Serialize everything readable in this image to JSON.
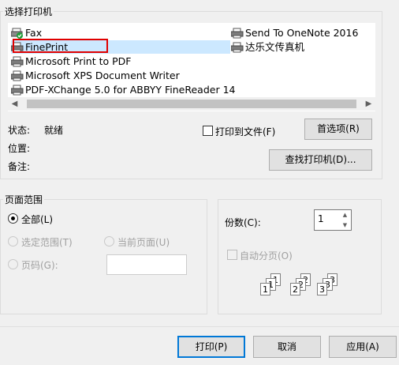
{
  "printer_group": {
    "title": "选择打印机"
  },
  "printers": {
    "col1": [
      "Fax",
      "FinePrint",
      "Microsoft Print to PDF",
      "Microsoft XPS Document Writer",
      "PDF-XChange 5.0 for ABBYY FineReader 14"
    ],
    "col2": [
      "Send To OneNote 2016",
      "达乐文传真机"
    ],
    "selected": "FinePrint",
    "highlight_color": "#e00000"
  },
  "info": {
    "status_label": "状态:",
    "status_value": "就绪",
    "location_label": "位置:",
    "comment_label": "备注:"
  },
  "print_to_file": {
    "label": "打印到文件(F)",
    "checked": false
  },
  "buttons": {
    "preferences": "首选项(R)",
    "find_printer": "查找打印机(D)...",
    "print": "打印(P)",
    "cancel": "取消",
    "apply": "应用(A)"
  },
  "page_range": {
    "title": "页面范围",
    "all": "全部(L)",
    "selection": "选定范围(T)",
    "current_page": "当前页面(U)",
    "pages": "页码(G):",
    "pages_value": ""
  },
  "copies": {
    "label": "份数(C):",
    "value": "1",
    "collate_label": "自动分页(O)",
    "collate_checked": false
  },
  "colors": {
    "accent": "#0078d7",
    "selection_bg": "#cce8ff"
  }
}
